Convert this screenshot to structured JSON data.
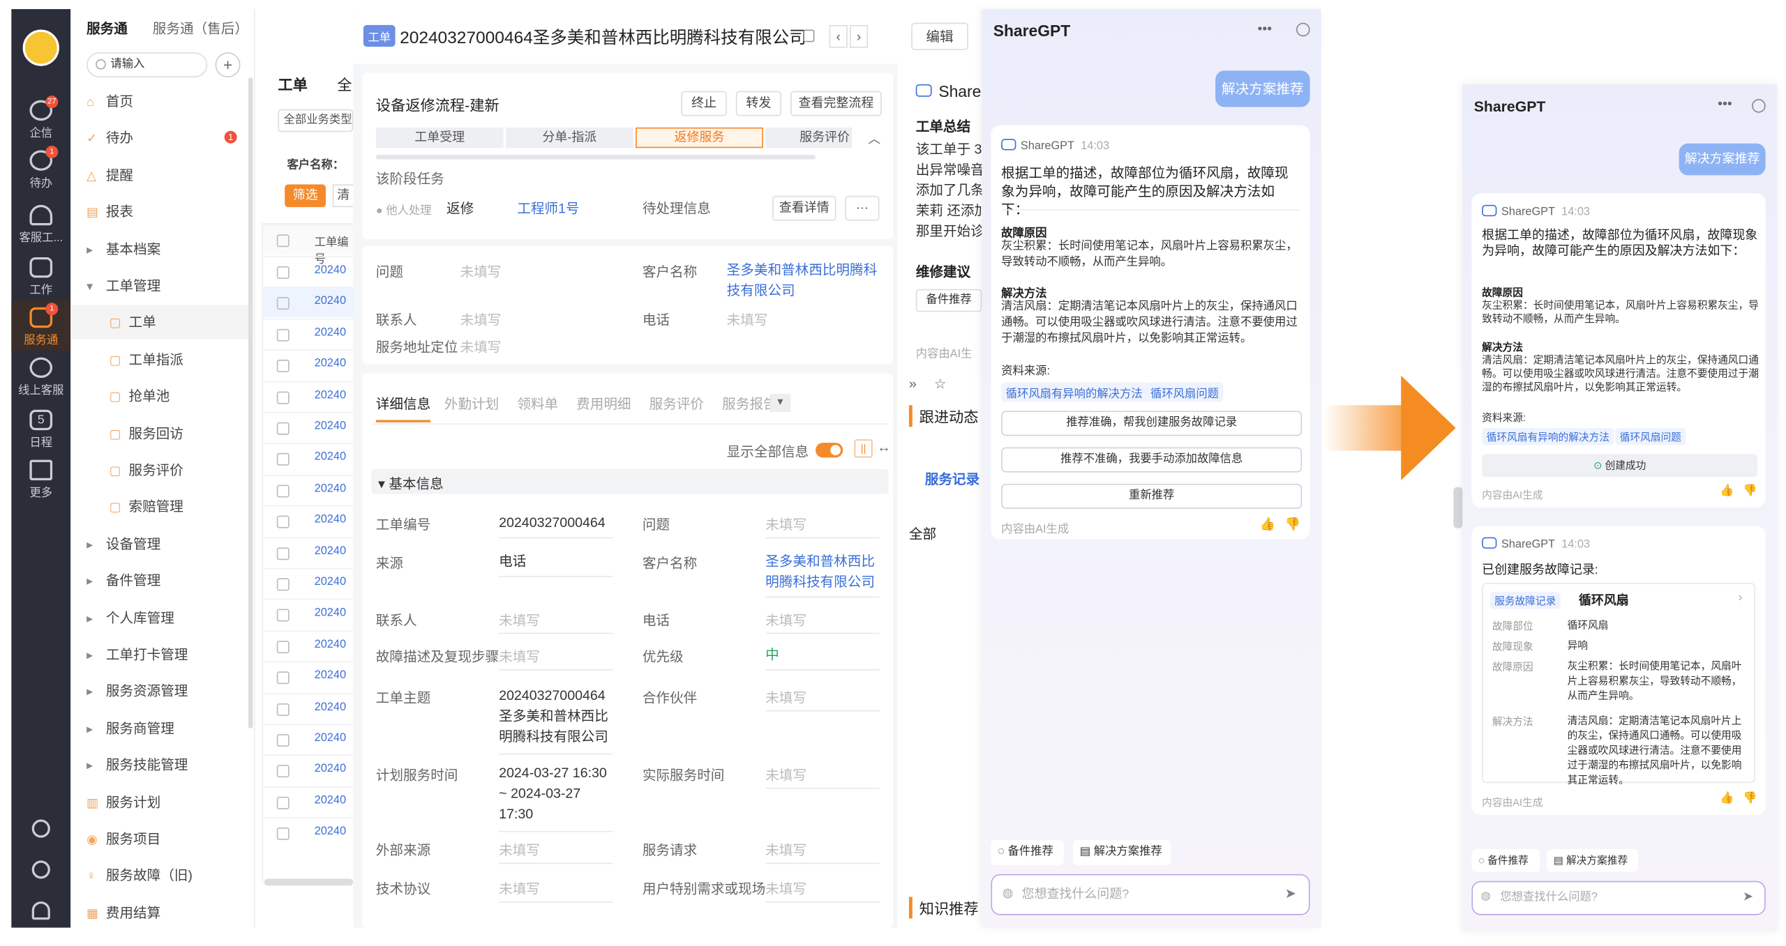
{
  "dark_nav": {
    "items": [
      {
        "label": "企信",
        "badge": "27"
      },
      {
        "label": "待办",
        "badge": "1"
      },
      {
        "label": "客服工..."
      },
      {
        "label": "工作"
      },
      {
        "label": "服务通",
        "badge": "1",
        "active": true
      },
      {
        "label": "线上客服"
      },
      {
        "label": "日程",
        "icon_text": "5"
      },
      {
        "label": "更多"
      }
    ]
  },
  "sidebar": {
    "app": "服务通",
    "space": "服务通（售后）",
    "search_placeholder": "请输入",
    "items": [
      {
        "label": "首页",
        "icon": "home-icon"
      },
      {
        "label": "待办",
        "icon": "check-icon",
        "badge": "1"
      },
      {
        "label": "提醒",
        "icon": "bell-icon"
      },
      {
        "label": "报表",
        "icon": "report-icon"
      },
      {
        "label": "基本档案",
        "group": true
      },
      {
        "label": "工单管理",
        "group": true,
        "open": true
      },
      {
        "label": "工单",
        "sub": true,
        "active": true
      },
      {
        "label": "工单指派",
        "sub": true
      },
      {
        "label": "抢单池",
        "sub": true
      },
      {
        "label": "服务回访",
        "sub": true
      },
      {
        "label": "服务评价",
        "sub": true
      },
      {
        "label": "索赔管理",
        "sub": true
      },
      {
        "label": "设备管理",
        "group": true
      },
      {
        "label": "备件管理",
        "group": true
      },
      {
        "label": "个人库管理",
        "group": true
      },
      {
        "label": "工单打卡管理",
        "group": true
      },
      {
        "label": "服务资源管理",
        "group": true
      },
      {
        "label": "服务商管理",
        "group": true
      },
      {
        "label": "服务技能管理",
        "group": true
      },
      {
        "label": "服务计划",
        "icon": "plan-icon"
      },
      {
        "label": "服务项目",
        "icon": "item-icon"
      },
      {
        "label": "服务故障（旧)",
        "icon": "bulb-icon"
      },
      {
        "label": "费用结算",
        "icon": "bill-icon"
      }
    ]
  },
  "list": {
    "tab1": "工单",
    "tab2": "全",
    "filter": "全部业务类型",
    "customer": "客户名称：",
    "btn_filter": "筛选",
    "btn_clear": "清",
    "header": "工单编号",
    "rows": [
      "20240",
      "20240",
      "20240",
      "20240",
      "20240",
      "20240",
      "20240",
      "20240",
      "20240",
      "20240",
      "20240",
      "20240",
      "20240",
      "20240",
      "20240",
      "20240",
      "20240",
      "20240",
      "20240"
    ]
  },
  "detail": {
    "badge": "工单",
    "title": "20240327000464圣多美和普林西比明腾科技有限公司",
    "edit": "编辑",
    "flow_name": "设备返修流程-建新",
    "btn_stop": "终止",
    "btn_forward": "转发",
    "btn_full": "查看完整流程",
    "steps": [
      "工单受理",
      "分单-指派",
      "返修服务",
      "服务评价"
    ],
    "stage_task": "该阶段任务",
    "task_status": "他人处理",
    "task_name": "返修",
    "task_owner": "工程师1号",
    "task_pending": "待处理信息",
    "btn_view": "查看详情",
    "more": "···",
    "top_fields": [
      {
        "label": "问题",
        "value": "未填写"
      },
      {
        "label": "客户名称",
        "value": "圣多美和普林西比明腾科技有限公司"
      },
      {
        "label": "联系人",
        "value": "未填写"
      },
      {
        "label": "电话",
        "value": "未填写"
      },
      {
        "label": "服务地址定位",
        "value": "未填写"
      }
    ],
    "tabs": [
      "详细信息",
      "外勤计划",
      "领料单",
      "费用明细",
      "服务评价",
      "服务报告"
    ],
    "show_all": "显示全部信息",
    "section": "基本信息",
    "fields": [
      {
        "label": "工单编号",
        "value": "20240327000464"
      },
      {
        "label": "问题",
        "value": "未填写"
      },
      {
        "label": "来源",
        "value": "电话"
      },
      {
        "label": "客户名称",
        "value": "圣多美和普林西比明腾科技有限公司"
      },
      {
        "label": "联系人",
        "value": "未填写"
      },
      {
        "label": "电话",
        "value": "未填写"
      },
      {
        "label": "故障描述及复现步骤",
        "value": "未填写"
      },
      {
        "label": "优先级",
        "value": "中"
      },
      {
        "label": "工单主题",
        "value": "20240327000464圣多美和普林西比明腾科技有限公司"
      },
      {
        "label": "合作伙伴",
        "value": "未填写"
      },
      {
        "label": "计划服务时间",
        "value": "2024-03-27 16:30 ~ 2024-03-27 17:30"
      },
      {
        "label": "实际服务时间",
        "value": "未填写"
      },
      {
        "label": "外部来源",
        "value": "未填写"
      },
      {
        "label": "服务请求",
        "value": "未填写"
      },
      {
        "label": "技术协议",
        "value": "未填写"
      },
      {
        "label": "用户特别需求或现场",
        "value": "未填写"
      }
    ]
  },
  "aux": {
    "title": "Share",
    "summary_title": "工单总结",
    "summary_lines": [
      "该工单于 3",
      "出异常噪音",
      "添加了几条",
      "茉莉 还添加",
      "那里开始诊"
    ],
    "advice_title": "维修建议",
    "advice_btn": "备件推荐",
    "ai_note": "内容由AI生成",
    "follow": "跟进动态",
    "record": "服务记录",
    "all": "全部",
    "knowledge": "知识推荐"
  },
  "chat_main": {
    "title": "ShareGPT",
    "user_msg": "解决方案推荐",
    "bot": "ShareGPT",
    "time": "14:03",
    "intro": "根据工单的描述，故障部位为循环风扇，故障现象为异响，故障可能产生的原因及解决方法如下：",
    "cause_title": "故障原因",
    "cause": "灰尘积累：长时间使用笔记本，风扇叶片上容易积累灰尘，导致转动不顺畅，从而产生异响。",
    "solution_title": "解决方法",
    "solution": "清洁风扇：定期清洁笔记本风扇叶片上的灰尘，保持通风口通畅。可以使用吸尘器或吹风球进行清洁。注意不要使用过于潮湿的布擦拭风扇叶片，以免影响其正常运转。",
    "source_title": "资料来源:",
    "sources": [
      "循环风扇有异响的解决方法",
      "循环风扇问题"
    ],
    "actions": [
      "推荐准确，帮我创建服务故障记录",
      "推荐不准确，我要手动添加故障信息",
      "重新推荐"
    ],
    "ai_note": "内容由AI生成",
    "chips": [
      "备件推荐",
      "解决方案推荐"
    ],
    "input_placeholder": "您想查找什么问题?"
  },
  "chat_side": {
    "title": "ShareGPT",
    "user_msg": "解决方案推荐",
    "bot": "ShareGPT",
    "time": "14:03",
    "intro": "根据工单的描述，故障部位为循环风扇，故障现象为异响，故障可能产生的原因及解决方法如下：",
    "cause_title": "故障原因",
    "cause": "灰尘积累：长时间使用笔记本，风扇叶片上容易积累灰尘，导致转动不顺畅，从而产生异响。",
    "solution_title": "解决方法",
    "solution": "清洁风扇：定期清洁笔记本风扇叶片上的灰尘，保持通风口通畅。可以使用吸尘器或吹风球进行清洁。注意不要使用过于潮湿的布擦拭风扇叶片，以免影响其正常运转。",
    "source_title": "资料来源:",
    "sources": [
      "循环风扇有异响的解决方法",
      "循环风扇问题"
    ],
    "created": "创建成功",
    "ai_note": "内容由AI生成",
    "bot2": "ShareGPT",
    "time2": "14:03",
    "created_msg": "已创建服务故障记录:",
    "record_tag": "服务故障记录",
    "record_name": "循环风扇",
    "record_fields": [
      {
        "label": "故障部位",
        "value": "循环风扇"
      },
      {
        "label": "故障现象",
        "value": "异响"
      },
      {
        "label": "故障原因",
        "value": "灰尘积累：长时间使用笔记本，风扇叶片上容易积累灰尘，导致转动不顺畅，从而产生异响。"
      },
      {
        "label": "解决方法",
        "value": "清洁风扇：定期清洁笔记本风扇叶片上的灰尘，保持通风口通畅。可以使用吸尘器或吹风球进行清洁。注意不要使用过于潮湿的布擦拭风扇叶片，以免影响其正常运转。"
      }
    ],
    "ai_note2": "内容由AI生成",
    "chips": [
      "备件推荐",
      "解决方案推荐"
    ],
    "input_placeholder": "您想查找什么问题?"
  },
  "colors": {
    "accent": "#f58a2a",
    "link": "#3b6fd8",
    "dark_nav": "#2b2e38",
    "pill": "#8eb3f5"
  }
}
